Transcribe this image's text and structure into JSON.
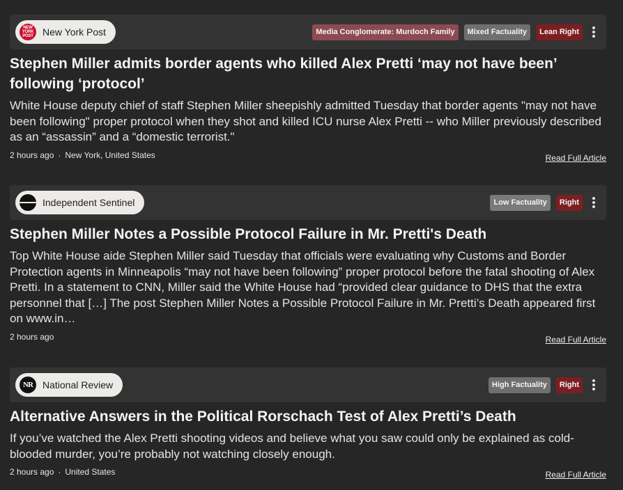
{
  "articles": [
    {
      "source": "New York Post",
      "logo_text": "NEW YORK POST",
      "badges": [
        "Media Conglomerate: Murdoch Family",
        "Mixed Factuality",
        "Lean Right"
      ],
      "headline": "Stephen Miller admits border agents who killed Alex Pretti ‘may not have been’ following ‘protocol’",
      "summary": "White House deputy chief of staff Stephen Miller sheepishly admitted Tuesday that border agents \"may not have been following\" proper protocol when they shot and killed ICU nurse Alex Pretti -- who Miller previously described as an “assassin” and a “domestic terrorist.\"",
      "time": "2 hours ago",
      "location": "New York, United States",
      "read_link": "Read Full Article"
    },
    {
      "source": "Independent Sentinel",
      "badges": [
        "Low Factuality",
        "Right"
      ],
      "headline": "Stephen Miller Notes a Possible Protocol Failure in Mr. Pretti's Death",
      "summary": "Top White House aide Stephen Miller said Tuesday that officials were evaluating why Customs and Border Protection agents in Minneapolis “may not have been following” proper protocol before the fatal shooting of Alex Pretti. In a statement to CNN, Miller said the White House had “provided clear guidance to DHS that the extra personnel that […] The post Stephen Miller Notes a Possible Protocol Failure in Mr. Pretti’s Death appeared first on www.in…",
      "time": "2 hours ago",
      "read_link": "Read Full Article"
    },
    {
      "source": "National Review",
      "logo_text": "NR",
      "badges": [
        "High Factuality",
        "Right"
      ],
      "headline": "Alternative Answers in the Political Rorschach Test of Alex Pretti’s Death",
      "summary": "If you’ve watched the Alex Pretti shooting videos and believe what you saw could only be explained as cold-blooded murder, you’re probably not watching closely enough.",
      "time": "2 hours ago",
      "location": "United States",
      "read_link": "Read Full Article"
    }
  ],
  "colors": {
    "background": "#262626",
    "header_bar": "#333333",
    "pill": "#ecebe8",
    "badge_media": "#8c4a52",
    "badge_factuality": "#6f6f6f",
    "badge_right": "#7c1f22",
    "nyp_red": "#c8102e"
  },
  "icons": {
    "more_menu": "kebab-vertical-icon",
    "independent_sentinel_logo": "sentinel-logo"
  }
}
